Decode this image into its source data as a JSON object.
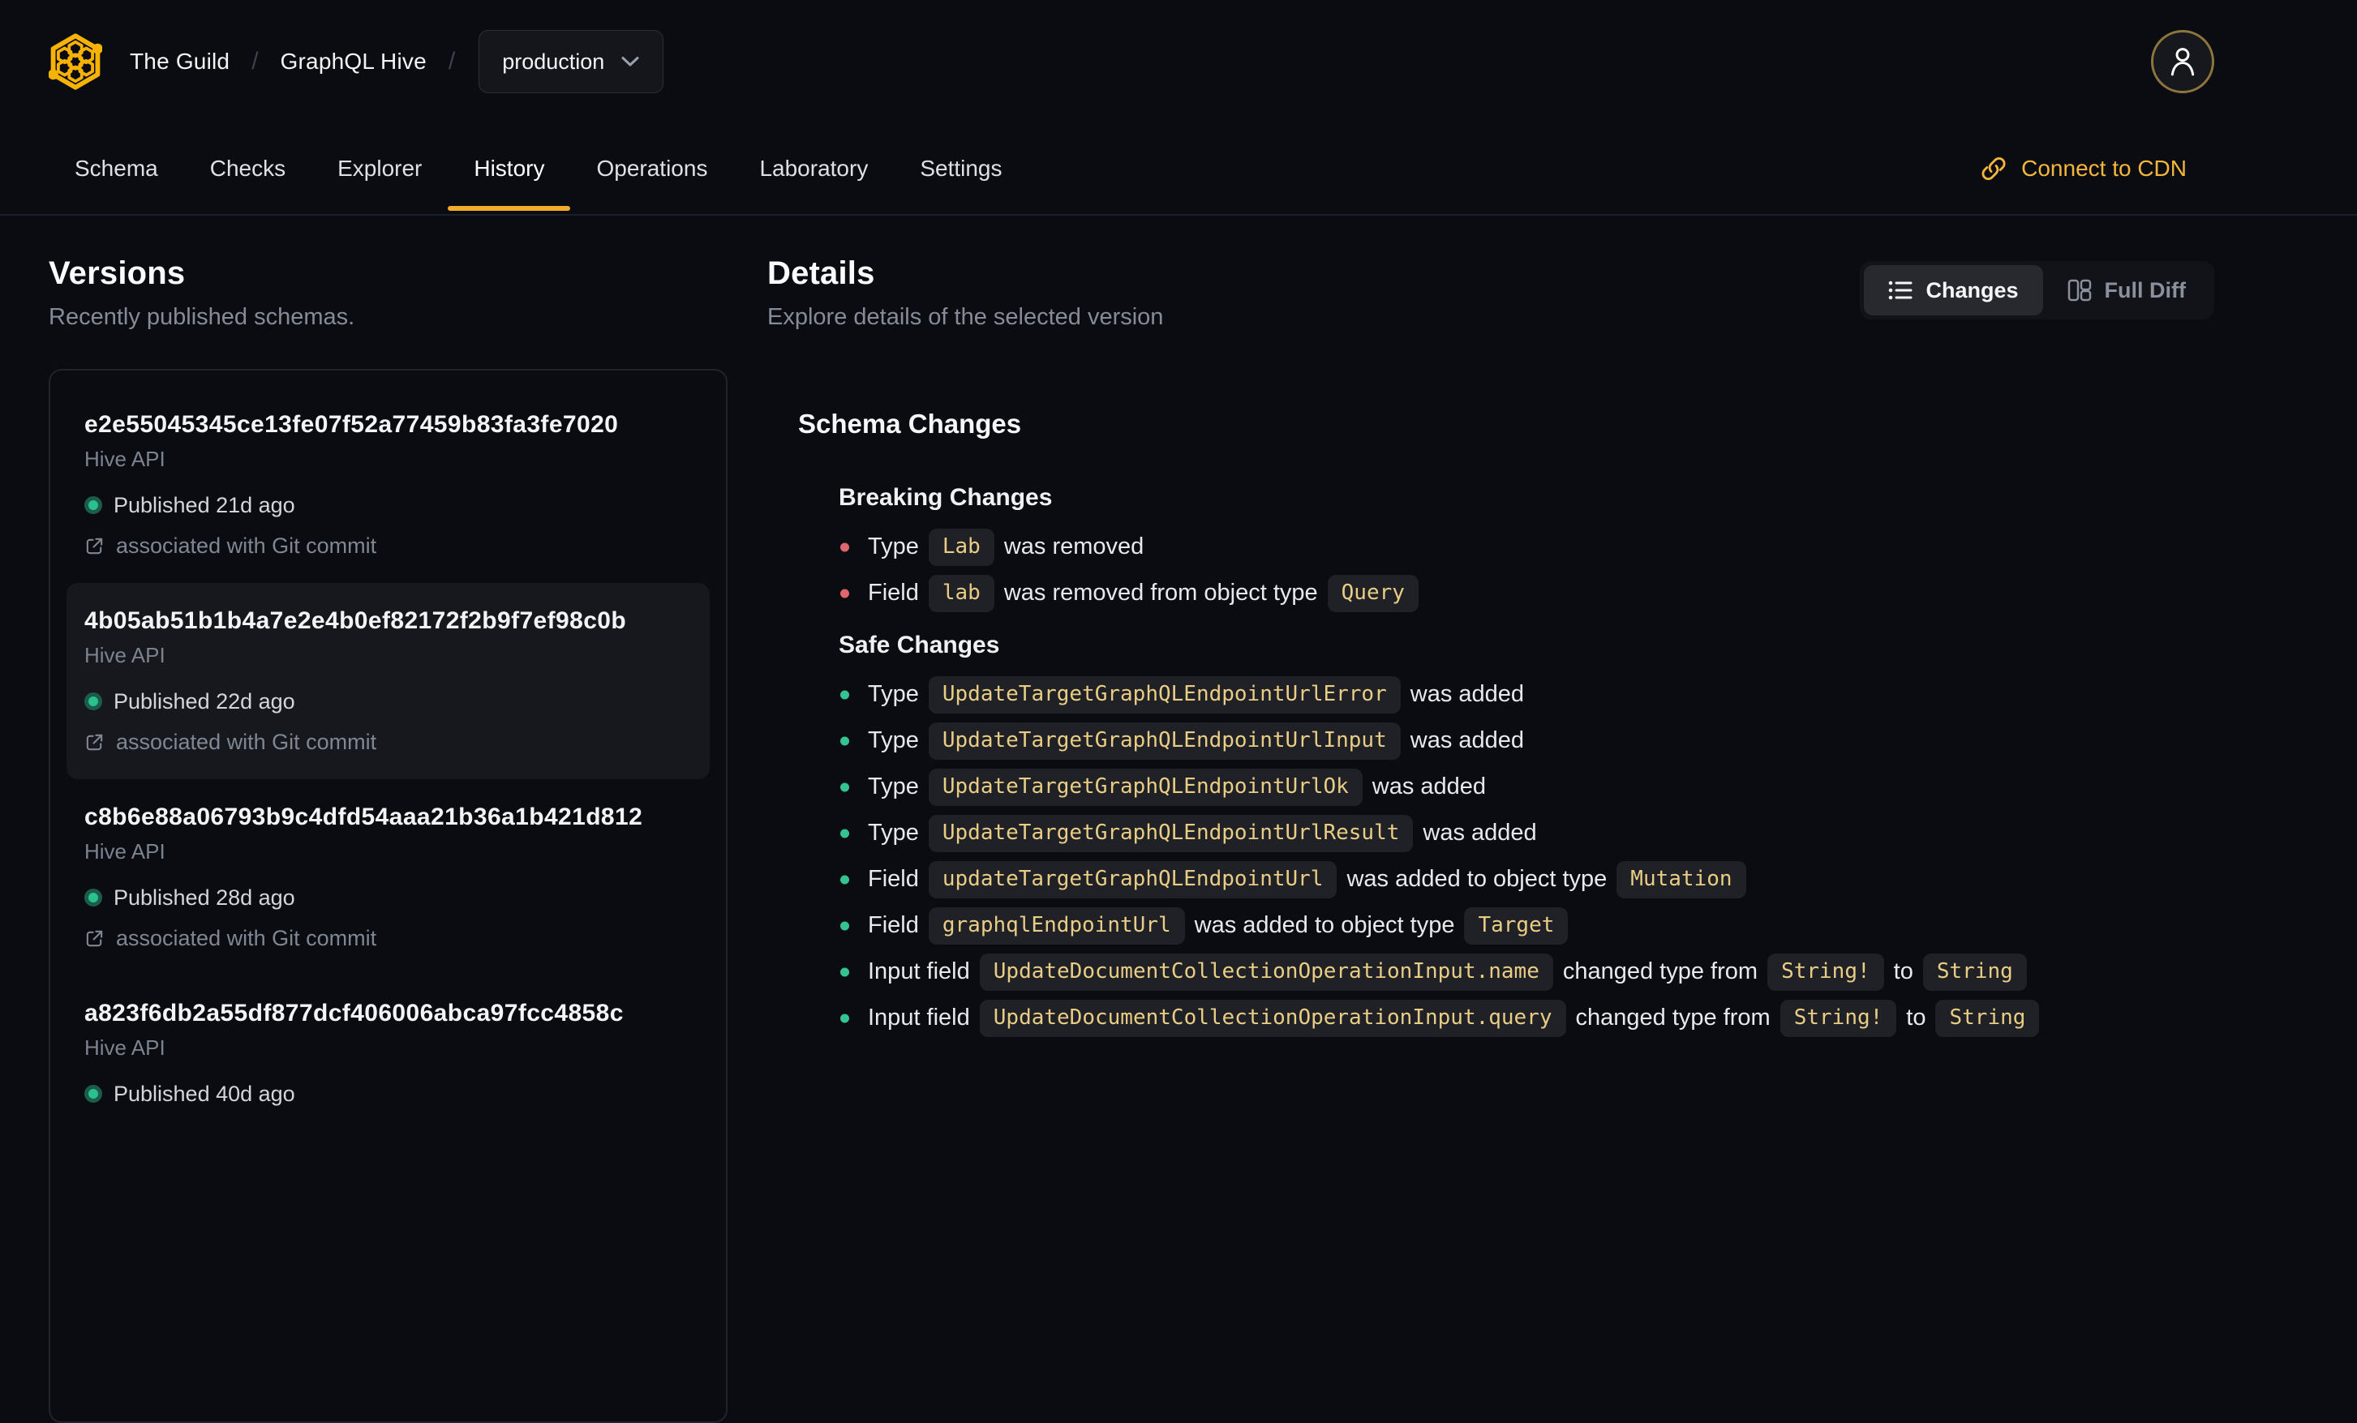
{
  "colors": {
    "accent": "#f4b63c",
    "tab_underline": "#f2ac2c",
    "page_bg": "#0a0c11",
    "chip_bg": "#1f2127",
    "chip_text": "#e9cd84",
    "breaking_bullet": "#e0666e",
    "safe_bullet": "#35c491",
    "published_dot": "#2bc18f"
  },
  "header": {
    "logo_icon": "graphql-hive-logo",
    "org": "The Guild",
    "separator": "/",
    "project": "GraphQL Hive",
    "target": "production",
    "user_icon": "user",
    "tabs": [
      {
        "label": "Schema",
        "active": false
      },
      {
        "label": "Checks",
        "active": false
      },
      {
        "label": "Explorer",
        "active": false
      },
      {
        "label": "History",
        "active": true
      },
      {
        "label": "Operations",
        "active": false
      },
      {
        "label": "Laboratory",
        "active": false
      },
      {
        "label": "Settings",
        "active": false
      }
    ],
    "cdn_link_label": "Connect to CDN"
  },
  "versions_panel": {
    "title": "Versions",
    "subtitle": "Recently published schemas.",
    "items": [
      {
        "hash": "e2e55045345ce13fe07f52a77459b83fa3fe7020",
        "service": "Hive API",
        "published": "Published 21d ago",
        "git_link": "associated with Git commit",
        "selected": false
      },
      {
        "hash": "4b05ab51b1b4a7e2e4b0ef82172f2b9f7ef98c0b",
        "service": "Hive API",
        "published": "Published 22d ago",
        "git_link": "associated with Git commit",
        "selected": true
      },
      {
        "hash": "c8b6e88a06793b9c4dfd54aaa21b36a1b421d812",
        "service": "Hive API",
        "published": "Published 28d ago",
        "git_link": "associated with Git commit",
        "selected": false
      },
      {
        "hash": "a823f6db2a55df877dcf406006abca97fcc4858c",
        "service": "Hive API",
        "published": "Published 40d ago",
        "git_link": null,
        "selected": false
      }
    ]
  },
  "details_panel": {
    "title": "Details",
    "subtitle": "Explore details of the selected version",
    "view_toggle": [
      {
        "label": "Changes",
        "icon": "list-icon",
        "active": true
      },
      {
        "label": "Full Diff",
        "icon": "split-panel-icon",
        "active": false
      }
    ],
    "schema_changes_title": "Schema Changes",
    "sections": [
      {
        "title": "Breaking Changes",
        "kind": "breaking",
        "items": [
          [
            {
              "t": "Type"
            },
            {
              "c": "Lab"
            },
            {
              "t": "was removed"
            }
          ],
          [
            {
              "t": "Field"
            },
            {
              "c": "lab"
            },
            {
              "t": "was removed from object type"
            },
            {
              "c": "Query"
            }
          ]
        ]
      },
      {
        "title": "Safe Changes",
        "kind": "safe",
        "items": [
          [
            {
              "t": "Type"
            },
            {
              "c": "UpdateTargetGraphQLEndpointUrlError"
            },
            {
              "t": "was added"
            }
          ],
          [
            {
              "t": "Type"
            },
            {
              "c": "UpdateTargetGraphQLEndpointUrlInput"
            },
            {
              "t": "was added"
            }
          ],
          [
            {
              "t": "Type"
            },
            {
              "c": "UpdateTargetGraphQLEndpointUrlOk"
            },
            {
              "t": "was added"
            }
          ],
          [
            {
              "t": "Type"
            },
            {
              "c": "UpdateTargetGraphQLEndpointUrlResult"
            },
            {
              "t": "was added"
            }
          ],
          [
            {
              "t": "Field"
            },
            {
              "c": "updateTargetGraphQLEndpointUrl"
            },
            {
              "t": "was added to object type"
            },
            {
              "c": "Mutation"
            }
          ],
          [
            {
              "t": "Field"
            },
            {
              "c": "graphqlEndpointUrl"
            },
            {
              "t": "was added to object type"
            },
            {
              "c": "Target"
            }
          ],
          [
            {
              "t": "Input field"
            },
            {
              "c": "UpdateDocumentCollectionOperationInput.name"
            },
            {
              "t": "changed type from"
            },
            {
              "c": "String!"
            },
            {
              "t": "to"
            },
            {
              "c": "String"
            }
          ],
          [
            {
              "t": "Input field"
            },
            {
              "c": "UpdateDocumentCollectionOperationInput.query"
            },
            {
              "t": "changed type from"
            },
            {
              "c": "String!"
            },
            {
              "t": "to"
            },
            {
              "c": "String"
            }
          ]
        ]
      }
    ]
  }
}
